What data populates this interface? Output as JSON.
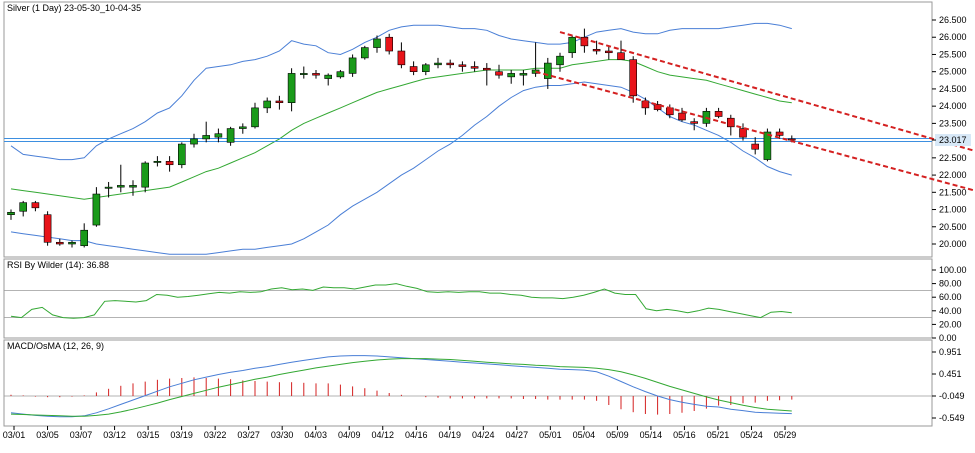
{
  "chart_data": [
    {
      "type": "candlestick",
      "title": "Silver (1 Day) 23-05-30_10-04-35",
      "yticks": [
        "26.500",
        "26.000",
        "25.500",
        "25.000",
        "24.500",
        "24.000",
        "23.500",
        "23.017",
        "22.500",
        "22.000",
        "21.500",
        "21.000",
        "20.500",
        "20.000"
      ],
      "ylim": [
        19.75,
        26.6
      ],
      "current_price": 23.017,
      "current_price_label": "23.017",
      "overlays": [
        "Bollinger upper",
        "Bollinger middle",
        "Bollinger lower",
        "descending channel (red dashed)",
        "horizontal level (blue)"
      ],
      "candles": [
        {
          "o": 20.85,
          "h": 21.0,
          "l": 20.7,
          "c": 20.92
        },
        {
          "o": 20.95,
          "h": 21.25,
          "l": 20.8,
          "c": 21.2
        },
        {
          "o": 21.2,
          "h": 21.25,
          "l": 20.95,
          "c": 21.05
        },
        {
          "o": 20.85,
          "h": 20.95,
          "l": 19.95,
          "c": 20.05
        },
        {
          "o": 20.05,
          "h": 20.15,
          "l": 19.95,
          "c": 20.0
        },
        {
          "o": 20.0,
          "h": 20.1,
          "l": 19.9,
          "c": 20.05
        },
        {
          "o": 19.95,
          "h": 20.6,
          "l": 19.9,
          "c": 20.4
        },
        {
          "o": 20.55,
          "h": 21.65,
          "l": 20.5,
          "c": 21.45
        },
        {
          "o": 21.65,
          "h": 21.8,
          "l": 21.35,
          "c": 21.65
        },
        {
          "o": 21.65,
          "h": 22.3,
          "l": 21.5,
          "c": 21.7
        },
        {
          "o": 21.65,
          "h": 21.85,
          "l": 21.4,
          "c": 21.7
        },
        {
          "o": 21.65,
          "h": 22.4,
          "l": 21.5,
          "c": 22.35
        },
        {
          "o": 22.4,
          "h": 22.55,
          "l": 22.25,
          "c": 22.4
        },
        {
          "o": 22.4,
          "h": 22.55,
          "l": 22.1,
          "c": 22.3
        },
        {
          "o": 22.3,
          "h": 22.95,
          "l": 22.2,
          "c": 22.9
        },
        {
          "o": 22.9,
          "h": 23.2,
          "l": 22.8,
          "c": 23.05
        },
        {
          "o": 23.05,
          "h": 23.55,
          "l": 22.95,
          "c": 23.15
        },
        {
          "o": 23.1,
          "h": 23.35,
          "l": 22.95,
          "c": 23.2
        },
        {
          "o": 22.95,
          "h": 23.4,
          "l": 22.85,
          "c": 23.35
        },
        {
          "o": 23.35,
          "h": 23.5,
          "l": 23.2,
          "c": 23.4
        },
        {
          "o": 23.4,
          "h": 24.1,
          "l": 23.35,
          "c": 23.95
        },
        {
          "o": 23.95,
          "h": 24.25,
          "l": 23.8,
          "c": 24.15
        },
        {
          "o": 24.15,
          "h": 24.3,
          "l": 23.9,
          "c": 24.1
        },
        {
          "o": 24.1,
          "h": 25.1,
          "l": 23.85,
          "c": 24.95
        },
        {
          "o": 24.95,
          "h": 25.15,
          "l": 24.8,
          "c": 24.95
        },
        {
          "o": 24.95,
          "h": 25.05,
          "l": 24.8,
          "c": 24.9
        },
        {
          "o": 24.8,
          "h": 24.95,
          "l": 24.6,
          "c": 24.9
        },
        {
          "o": 24.85,
          "h": 25.05,
          "l": 24.8,
          "c": 25.0
        },
        {
          "o": 24.95,
          "h": 25.5,
          "l": 24.85,
          "c": 25.4
        },
        {
          "o": 25.4,
          "h": 25.75,
          "l": 25.35,
          "c": 25.7
        },
        {
          "o": 25.7,
          "h": 26.05,
          "l": 25.55,
          "c": 25.95
        },
        {
          "o": 26.0,
          "h": 26.1,
          "l": 25.5,
          "c": 25.6
        },
        {
          "o": 25.6,
          "h": 25.85,
          "l": 25.1,
          "c": 25.2
        },
        {
          "o": 25.15,
          "h": 25.3,
          "l": 24.9,
          "c": 25.0
        },
        {
          "o": 25.0,
          "h": 25.25,
          "l": 24.9,
          "c": 25.2
        },
        {
          "o": 25.2,
          "h": 25.4,
          "l": 25.1,
          "c": 25.25
        },
        {
          "o": 25.25,
          "h": 25.35,
          "l": 25.1,
          "c": 25.2
        },
        {
          "o": 25.2,
          "h": 25.3,
          "l": 25.0,
          "c": 25.15
        },
        {
          "o": 25.15,
          "h": 25.3,
          "l": 25.0,
          "c": 25.1
        },
        {
          "o": 25.1,
          "h": 25.25,
          "l": 24.6,
          "c": 25.05
        },
        {
          "o": 25.0,
          "h": 25.2,
          "l": 24.8,
          "c": 24.9
        },
        {
          "o": 24.85,
          "h": 25.05,
          "l": 24.65,
          "c": 24.95
        },
        {
          "o": 24.9,
          "h": 25.05,
          "l": 24.6,
          "c": 24.95
        },
        {
          "o": 24.95,
          "h": 25.85,
          "l": 24.85,
          "c": 25.05
        },
        {
          "o": 24.8,
          "h": 25.4,
          "l": 24.5,
          "c": 25.25
        },
        {
          "o": 25.2,
          "h": 25.55,
          "l": 25.0,
          "c": 25.45
        },
        {
          "o": 25.55,
          "h": 26.05,
          "l": 25.4,
          "c": 26.0
        },
        {
          "o": 26.0,
          "h": 26.25,
          "l": 25.55,
          "c": 25.75
        },
        {
          "o": 25.65,
          "h": 25.9,
          "l": 25.5,
          "c": 25.6
        },
        {
          "o": 25.6,
          "h": 25.75,
          "l": 25.35,
          "c": 25.55
        },
        {
          "o": 25.55,
          "h": 25.9,
          "l": 25.4,
          "c": 25.35
        },
        {
          "o": 25.35,
          "h": 25.45,
          "l": 24.1,
          "c": 24.3
        },
        {
          "o": 24.15,
          "h": 24.25,
          "l": 23.75,
          "c": 23.95
        },
        {
          "o": 24.05,
          "h": 24.15,
          "l": 23.85,
          "c": 23.9
        },
        {
          "o": 23.95,
          "h": 24.05,
          "l": 23.65,
          "c": 23.75
        },
        {
          "o": 23.8,
          "h": 23.95,
          "l": 23.55,
          "c": 23.6
        },
        {
          "o": 23.55,
          "h": 23.65,
          "l": 23.3,
          "c": 23.5
        },
        {
          "o": 23.5,
          "h": 23.95,
          "l": 23.4,
          "c": 23.85
        },
        {
          "o": 23.85,
          "h": 23.95,
          "l": 23.65,
          "c": 23.7
        },
        {
          "o": 23.65,
          "h": 23.75,
          "l": 23.15,
          "c": 23.4
        },
        {
          "o": 23.35,
          "h": 23.5,
          "l": 23.0,
          "c": 23.1
        },
        {
          "o": 22.9,
          "h": 23.1,
          "l": 22.6,
          "c": 22.75
        },
        {
          "o": 22.45,
          "h": 23.35,
          "l": 22.4,
          "c": 23.25
        },
        {
          "o": 23.25,
          "h": 23.35,
          "l": 23.05,
          "c": 23.15
        },
        {
          "o": 23.05,
          "h": 23.15,
          "l": 22.95,
          "c": 23.02
        }
      ],
      "bb_upper": [
        22.85,
        22.6,
        22.55,
        22.5,
        22.45,
        22.45,
        22.5,
        22.85,
        23.05,
        23.2,
        23.35,
        23.55,
        23.8,
        23.95,
        24.3,
        24.75,
        25.1,
        25.15,
        25.2,
        25.3,
        25.35,
        25.45,
        25.6,
        25.9,
        25.8,
        25.75,
        25.55,
        25.5,
        25.65,
        25.85,
        26.0,
        26.2,
        26.3,
        26.35,
        26.35,
        26.35,
        26.3,
        26.25,
        26.25,
        26.2,
        26.05,
        25.95,
        25.9,
        25.85,
        25.8,
        25.8,
        25.85,
        26.0,
        26.15,
        26.2,
        26.25,
        26.15,
        26.1,
        26.1,
        26.2,
        26.25,
        26.25,
        26.25,
        26.25,
        26.3,
        26.35,
        26.4,
        26.4,
        26.35,
        26.25
      ],
      "bb_middle": [
        21.6,
        21.55,
        21.5,
        21.45,
        21.4,
        21.35,
        21.3,
        21.35,
        21.4,
        21.45,
        21.5,
        21.55,
        21.6,
        21.65,
        21.8,
        21.95,
        22.1,
        22.2,
        22.35,
        22.5,
        22.65,
        22.85,
        23.05,
        23.3,
        23.5,
        23.65,
        23.8,
        23.95,
        24.1,
        24.25,
        24.4,
        24.5,
        24.6,
        24.7,
        24.8,
        24.85,
        24.9,
        24.95,
        25.0,
        25.05,
        25.05,
        25.05,
        25.05,
        25.1,
        25.1,
        25.1,
        25.2,
        25.25,
        25.3,
        25.35,
        25.35,
        25.3,
        25.15,
        25.0,
        24.9,
        24.85,
        24.8,
        24.75,
        24.65,
        24.55,
        24.45,
        24.35,
        24.25,
        24.15,
        24.1
      ],
      "bb_lower": [
        20.35,
        20.3,
        20.25,
        20.2,
        20.15,
        20.1,
        20.1,
        20.0,
        19.95,
        19.9,
        19.85,
        19.8,
        19.75,
        19.7,
        19.7,
        19.7,
        19.7,
        19.75,
        19.8,
        19.85,
        19.85,
        19.9,
        19.95,
        20.0,
        20.15,
        20.35,
        20.55,
        20.85,
        21.1,
        21.3,
        21.5,
        21.75,
        22.0,
        22.2,
        22.45,
        22.7,
        22.9,
        23.15,
        23.45,
        23.7,
        24.0,
        24.25,
        24.45,
        24.55,
        24.6,
        24.6,
        24.65,
        24.7,
        24.65,
        24.6,
        24.55,
        24.4,
        24.2,
        23.95,
        23.7,
        23.55,
        23.45,
        23.3,
        23.15,
        22.95,
        22.7,
        22.5,
        22.25,
        22.1,
        22.0
      ],
      "channel_upper": [
        [
          45,
          26.15
        ],
        [
          80,
          22.6
        ]
      ],
      "channel_lower": [
        [
          43,
          25.0
        ],
        [
          79,
          21.55
        ]
      ],
      "horizontal_level": 23.017
    },
    {
      "type": "line",
      "title": "RSI By Wilder (14): 36.88",
      "yticks": [
        "100.00",
        "80.00",
        "60.00",
        "40.00",
        "20.00",
        "0.00"
      ],
      "ylim": [
        0,
        100
      ],
      "levels": [
        70,
        30
      ],
      "series": [
        {
          "values": [
            32,
            30,
            42,
            45,
            34,
            30,
            29,
            30,
            34,
            54,
            55,
            54,
            53,
            55,
            64,
            63,
            60,
            61,
            63,
            65,
            67,
            66,
            68,
            67,
            68,
            72,
            74,
            71,
            72,
            70,
            75,
            74,
            74,
            72,
            75,
            78,
            78,
            80,
            76,
            73,
            68,
            67,
            68,
            67,
            68,
            68,
            66,
            66,
            64,
            63,
            60,
            59,
            59,
            58,
            60,
            63,
            67,
            72,
            66,
            64,
            64,
            43,
            40,
            42,
            40,
            37,
            40,
            44,
            42,
            39,
            36,
            33,
            30,
            38,
            39,
            37
          ]
        }
      ]
    },
    {
      "type": "line",
      "title": "MACD/OsMA (12, 26, 9)",
      "yticks": [
        "0.951",
        "0.451",
        "-0.049",
        "-0.549"
      ],
      "ylim": [
        -0.65,
        1.0
      ],
      "x": [
        "03/01",
        "03/05",
        "03/07",
        "03/12",
        "03/15",
        "03/19",
        "03/22",
        "03/27",
        "03/30",
        "04/03",
        "04/09",
        "04/12",
        "04/16",
        "04/19",
        "04/24",
        "04/27",
        "05/01",
        "05/04",
        "05/09",
        "05/14",
        "05/16",
        "05/21",
        "05/24",
        "05/29"
      ],
      "series": [
        {
          "values": [
            -0.43,
            -0.46,
            -0.49,
            -0.51,
            -0.52,
            -0.52,
            -0.5,
            -0.43,
            -0.34,
            -0.24,
            -0.14,
            -0.04,
            0.06,
            0.16,
            0.24,
            0.32,
            0.38,
            0.44,
            0.49,
            0.53,
            0.58,
            0.62,
            0.67,
            0.72,
            0.76,
            0.8,
            0.84,
            0.86,
            0.87,
            0.87,
            0.86,
            0.84,
            0.82,
            0.8,
            0.78,
            0.76,
            0.74,
            0.72,
            0.7,
            0.68,
            0.66,
            0.64,
            0.62,
            0.6,
            0.58,
            0.56,
            0.55,
            0.54,
            0.5,
            0.4,
            0.28,
            0.16,
            0.05,
            -0.05,
            -0.13,
            -0.19,
            -0.24,
            -0.28,
            -0.3,
            -0.35,
            -0.38,
            -0.42,
            -0.43,
            -0.44,
            -0.45
          ]
        },
        {
          "values": [
            -0.46,
            -0.47,
            -0.48,
            -0.49,
            -0.5,
            -0.51,
            -0.51,
            -0.49,
            -0.46,
            -0.41,
            -0.35,
            -0.28,
            -0.21,
            -0.13,
            -0.06,
            0.01,
            0.08,
            0.15,
            0.21,
            0.27,
            0.33,
            0.38,
            0.44,
            0.49,
            0.54,
            0.59,
            0.63,
            0.67,
            0.71,
            0.74,
            0.77,
            0.79,
            0.8,
            0.8,
            0.8,
            0.79,
            0.78,
            0.76,
            0.74,
            0.72,
            0.7,
            0.68,
            0.67,
            0.65,
            0.64,
            0.62,
            0.61,
            0.6,
            0.58,
            0.55,
            0.5,
            0.43,
            0.35,
            0.26,
            0.17,
            0.09,
            0.01,
            -0.07,
            -0.14,
            -0.2,
            -0.26,
            -0.31,
            -0.35,
            -0.37,
            -0.39
          ]
        }
      ],
      "histogram": [
        0.02,
        0.01,
        -0.01,
        -0.02,
        -0.02,
        -0.01,
        0.01,
        0.06,
        0.12,
        0.17,
        0.21,
        0.24,
        0.27,
        0.29,
        0.3,
        0.31,
        0.3,
        0.29,
        0.28,
        0.26,
        0.25,
        0.24,
        0.23,
        0.23,
        0.22,
        0.21,
        0.21,
        0.19,
        0.16,
        0.13,
        0.09,
        0.05,
        0.02,
        0.0,
        -0.02,
        -0.03,
        -0.04,
        -0.04,
        -0.04,
        -0.04,
        -0.04,
        -0.04,
        -0.05,
        -0.05,
        -0.06,
        -0.06,
        -0.06,
        -0.06,
        -0.08,
        -0.15,
        -0.22,
        -0.27,
        -0.3,
        -0.31,
        -0.3,
        -0.28,
        -0.25,
        -0.21,
        -0.16,
        -0.15,
        -0.12,
        -0.11,
        -0.08,
        -0.07,
        -0.06
      ]
    }
  ],
  "colors": {
    "bull": "#1a9a1a",
    "bear": "#e8141a",
    "bb_outer": "#4a7fd6",
    "bb_middle": "#33a833",
    "channel": "#d42020",
    "level": "#3d8fe0",
    "rsi": "#33a833",
    "macd": "#4a7fd6",
    "signal": "#33a833",
    "hist": "#d42020",
    "grid": "#cfcfcf",
    "price_label_bg": "#d7e8f7"
  }
}
